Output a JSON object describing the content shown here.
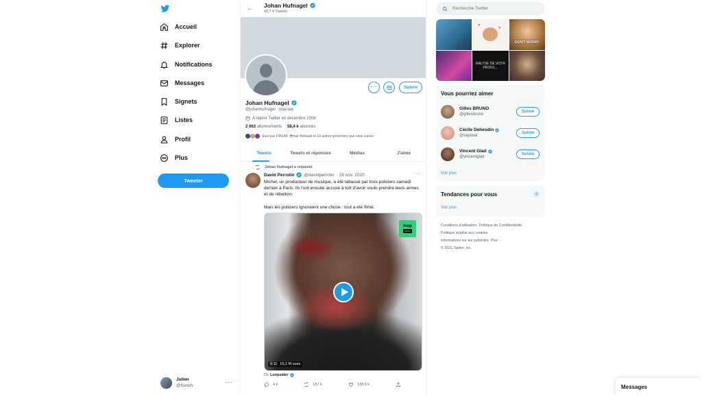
{
  "colors": {
    "accent": "#1d9bf0",
    "text": "#0f1419",
    "muted": "#536471",
    "banner": "#cfd9de"
  },
  "nav": {
    "logo_icon": "twitter-bird-icon",
    "items": [
      {
        "label": "Accueil",
        "icon": "home-icon"
      },
      {
        "label": "Explorer",
        "icon": "hashtag-icon"
      },
      {
        "label": "Notifications",
        "icon": "bell-icon"
      },
      {
        "label": "Messages",
        "icon": "envelope-icon"
      },
      {
        "label": "Signets",
        "icon": "bookmark-icon"
      },
      {
        "label": "Listes",
        "icon": "list-icon"
      },
      {
        "label": "Profil",
        "icon": "person-icon"
      },
      {
        "label": "Plus",
        "icon": "more-circle-icon"
      }
    ],
    "tweet_button": "Tweeter",
    "account": {
      "name": "Julien",
      "handle": "@foxteh"
    }
  },
  "profile": {
    "header_name": "Johan Hufnagel",
    "header_count": "43,7 k Tweets",
    "name": "Johan Hufnagel",
    "handle": "@johanhufnagel",
    "follows_you": "Vous suit",
    "joined": "A rejoint Twitter en décembre 2008",
    "following_count": "2 063",
    "following_label": "abonnements",
    "followers_count": "58,4 k",
    "followers_label": "abonnés",
    "followed_by": "Suivi par DINUM, 😎mar Belkaab et 19 autres personnes que vous suivez",
    "follow_button": "Suivre"
  },
  "tabs": [
    "Tweets",
    "Tweets et réponses",
    "Médias",
    "J'aime"
  ],
  "tweet": {
    "retweeted_by": "Johan Hufnagel a retweeté",
    "author": "David Perrotin",
    "handle": "@davidperrotin",
    "date": "· 26 nov. 2020",
    "text_1": "Michel, un producteur de musique, a été tabassé par trois policiers samedi dernier à Paris. Ils l'ont ensuite accusé à tort d'avoir voulu prendre leurs armes et de rébellion.",
    "text_2": "Mais les policiers ignoraient une chose : tout a été filmé.",
    "media_badge_1": "loop",
    "media_badge_2": "sider",
    "video_time": "9:11",
    "video_views": "15,1 M vues",
    "from_prefix": "De",
    "from_name": "Loopsider",
    "replies": "4 k",
    "retweets": "157 k",
    "likes": "138,6 k"
  },
  "right": {
    "search_placeholder": "Recherche Twitter",
    "gallery_caption_1": "DON'T WORRY",
    "gallery_caption_2": "NALYSE DE VOTR PROFIL...",
    "suggest_title": "Vous pourriez aimer",
    "suggestions": [
      {
        "name": "Gilles BRUNO",
        "handle": "@gillesbruno",
        "verified": false,
        "button": "Suivre",
        "color": "#7a6a55"
      },
      {
        "name": "Cécile Dehesdin",
        "handle": "@sayseal",
        "verified": true,
        "button": "Suivre",
        "color": "#c98a7a"
      },
      {
        "name": "Vincent Glad",
        "handle": "@vincentglad",
        "verified": true,
        "button": "Suivre",
        "color": "#5a3a2a"
      }
    ],
    "suggest_more": "Voir plus",
    "trends_title": "Tendances pour vous",
    "trends_more": "Voir plus",
    "footer_1": "Conditions d'utilisation",
    "footer_2": "Politique de Confidentialité",
    "footer_3": "Politique relative aux cookies",
    "footer_4": "Informations sur les publicités",
    "footer_5": "Plus ···",
    "footer_6": "© 2021 Twitter, Inc."
  },
  "messages_drawer": "Messages"
}
